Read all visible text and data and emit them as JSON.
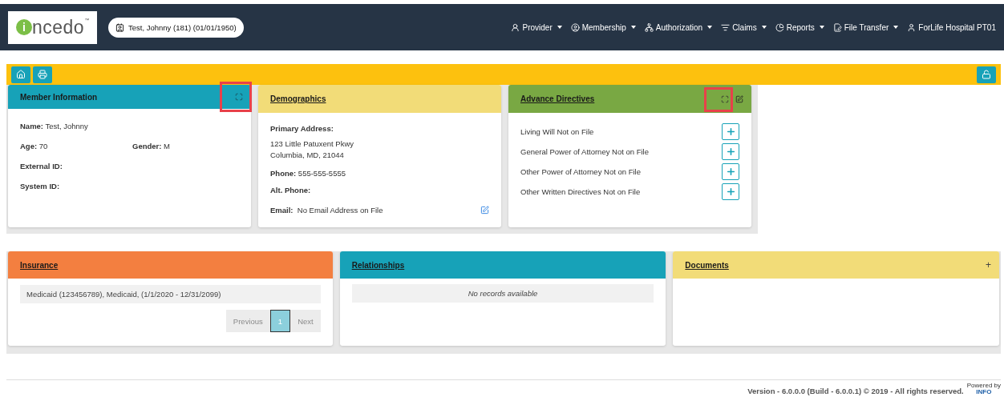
{
  "header": {
    "logo": {
      "mark": "i",
      "text": "ncedo",
      "tm": "™"
    },
    "patient": "Test, Johnny (181) (01/01/1950)",
    "nav": [
      {
        "label": "Provider",
        "dropdown": true
      },
      {
        "label": "Membership",
        "dropdown": true
      },
      {
        "label": "Authorization",
        "dropdown": true
      },
      {
        "label": "Claims",
        "dropdown": true
      },
      {
        "label": "Reports",
        "dropdown": true
      },
      {
        "label": "File Transfer",
        "dropdown": true
      },
      {
        "label": "ForLife Hospital PT01",
        "dropdown": false
      }
    ]
  },
  "toolbar": {
    "buttons": [
      {
        "kind": "home"
      },
      {
        "kind": "print"
      }
    ],
    "lock": {
      "kind": "unlock"
    }
  },
  "member_info": {
    "title": "Member Information",
    "expand_highlighted": true,
    "fields": [
      {
        "label": "Name:",
        "value": "Test, Johnny"
      },
      {
        "label": "Age:",
        "value": "70"
      },
      {
        "label": "Gender:",
        "value": "M"
      },
      {
        "label": "External ID:"
      },
      {
        "label": "System ID:"
      }
    ]
  },
  "demographics": {
    "title": "Demographics",
    "address_label": "Primary Address:",
    "address_lines": [
      "123 Little Patuxent Pkwy",
      "Columbia, MD, 21044"
    ],
    "phone_label": "Phone:",
    "phone": "555-555-5555",
    "alt_phone_label": "Alt. Phone:",
    "email_label": "Email:",
    "email": "No Email Address on File"
  },
  "advance_directives": {
    "title": "Advance Directives",
    "expand_highlighted": true,
    "items": [
      "Living Will Not on File",
      "General Power of Attorney Not on File",
      "Other Power of Attorney Not on File",
      "Other Written Directives Not on File"
    ]
  },
  "insurance": {
    "title": "Insurance",
    "rows": [
      "Medicaid (123456789), Medicaid, (1/1/2020 - 12/31/2099)"
    ],
    "pagination": [
      {
        "label": "Previous",
        "disabled": true,
        "selected": false
      },
      {
        "label": "1",
        "disabled": false,
        "selected": true
      },
      {
        "label": "Next",
        "disabled": true,
        "selected": false
      }
    ]
  },
  "relationships": {
    "title": "Relationships",
    "empty": "No records available"
  },
  "documents": {
    "title": "Documents",
    "add": "+"
  },
  "footer": {
    "version": "Version - 6.0.0.0 (Build - 6.0.0.1) © 2019 - All rights reserved.",
    "badge_top": "Powered by",
    "badge": "INFO"
  }
}
